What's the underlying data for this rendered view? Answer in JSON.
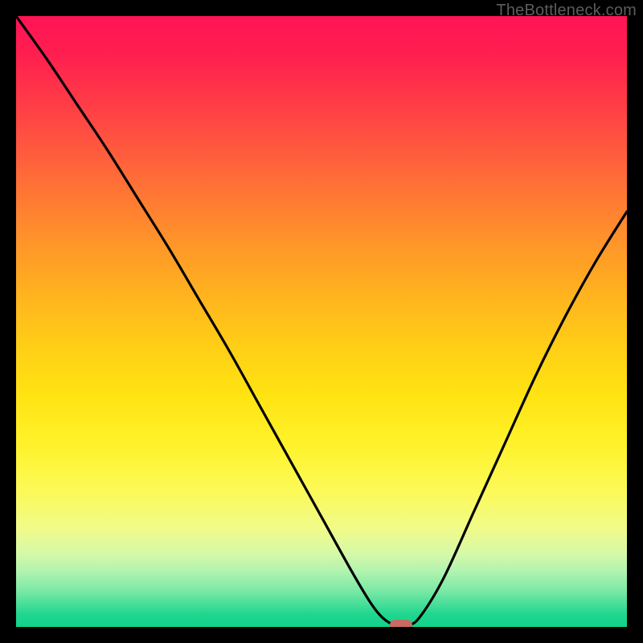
{
  "watermark": "TheBottleneck.com",
  "chart_data": {
    "type": "line",
    "title": "",
    "xlabel": "",
    "ylabel": "",
    "xlim": [
      0,
      100
    ],
    "ylim": [
      0,
      100
    ],
    "gradient_stops": [
      {
        "pct": 0,
        "color": "#ff1455"
      },
      {
        "pct": 100,
        "color": "#11d38c"
      }
    ],
    "x": [
      0,
      5,
      10,
      15,
      20,
      25,
      30,
      35,
      40,
      45,
      50,
      55,
      58,
      60,
      62,
      64,
      66,
      70,
      75,
      80,
      85,
      90,
      95,
      100
    ],
    "values": [
      100,
      93,
      85.5,
      78,
      70,
      62,
      53.5,
      45,
      36,
      27,
      18,
      9,
      4,
      1.5,
      0.3,
      0.3,
      1.5,
      8,
      19,
      30,
      41,
      51,
      60,
      68
    ],
    "marker": {
      "x": 63,
      "y": 0.3
    }
  }
}
